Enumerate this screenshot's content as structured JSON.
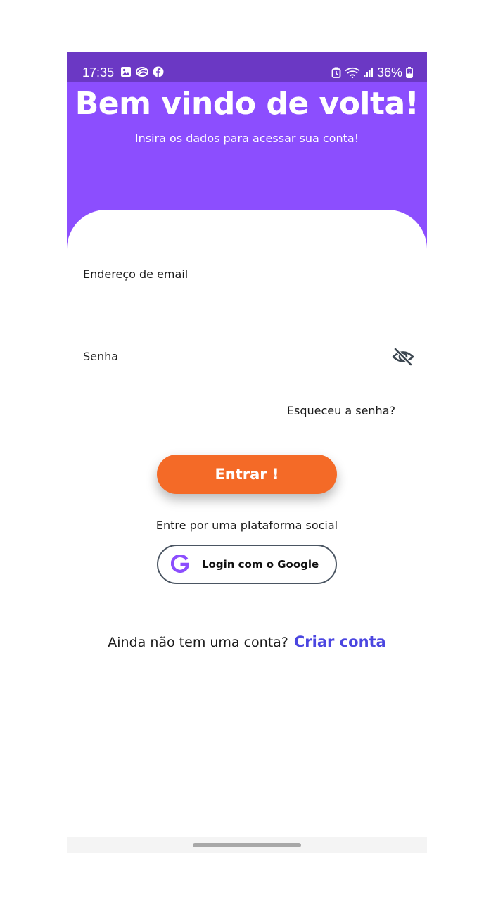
{
  "status_bar": {
    "time": "17:35",
    "battery": "36%",
    "left_icons": [
      "image-icon",
      "swirl-app-icon",
      "facebook-icon"
    ],
    "right_icons": [
      "alarm-icon",
      "wifi-icon",
      "signal-icon",
      "battery-icon"
    ]
  },
  "header": {
    "title": "Bem vindo de volta!",
    "subtitle": "Insira os dados para acessar sua conta!"
  },
  "form": {
    "email_label": "Endereço de email",
    "password_label": "Senha",
    "password_toggle_icon": "eye-off-icon",
    "forgot_password": "Esqueceu a senha?",
    "submit_label": "Entrar !"
  },
  "social": {
    "prompt": "Entre por uma plataforma social",
    "google_label": "Login com o Google",
    "google_icon": "google-icon"
  },
  "signup": {
    "prompt": "Ainda não tem uma conta?",
    "link": "Criar conta"
  },
  "colors": {
    "status_bar": "#6b38c4",
    "header": "#8c4efe",
    "primary_button": "#f46a27",
    "link": "#4b46e0",
    "google_icon": "#8c4efe"
  }
}
